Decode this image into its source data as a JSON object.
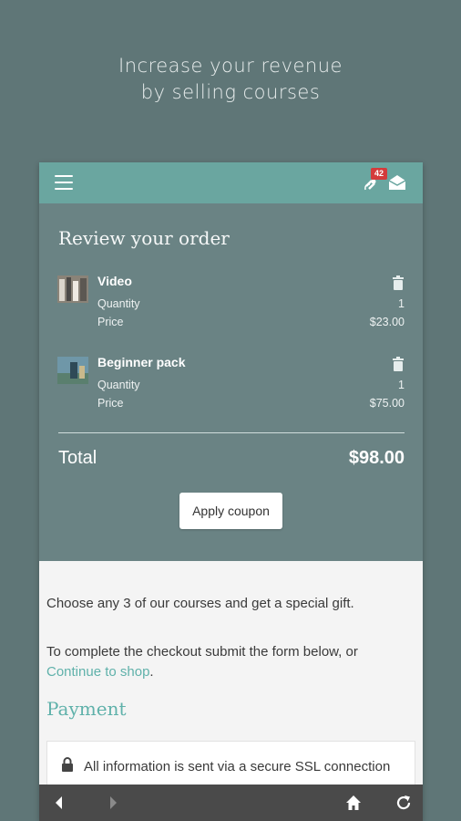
{
  "promo": {
    "line1": "Increase your revenue",
    "line2": "by selling courses"
  },
  "appbar": {
    "badge_count": "42",
    "menu_icon": "hamburger-menu-icon",
    "satellite_icon": "satellite-icon",
    "mail_icon": "mail-open-icon"
  },
  "review": {
    "title": "Review your order",
    "items": [
      {
        "name": "Video",
        "quantity_label": "Quantity",
        "quantity": "1",
        "price_label": "Price",
        "price": "$23.00"
      },
      {
        "name": "Beginner pack",
        "quantity_label": "Quantity",
        "quantity": "1",
        "price_label": "Price",
        "price": "$75.00"
      }
    ],
    "total_label": "Total",
    "total_value": "$98.00",
    "coupon_label": "Apply coupon"
  },
  "content": {
    "gift_text": "Choose any 3 of our courses and get a special gift.",
    "checkout_text": "To complete the checkout submit the form below, or",
    "continue_link": "Continue to shop",
    "period": ".",
    "payment_heading": "Payment",
    "secure_text": "All information is sent via a secure SSL connection"
  },
  "colors": {
    "background": "#5f7677",
    "appbar": "#6aa6a0",
    "review_panel": "#6a8384",
    "accent": "#5fb1aa",
    "badge": "#d43b3b",
    "navbar": "#4a4a4a"
  }
}
